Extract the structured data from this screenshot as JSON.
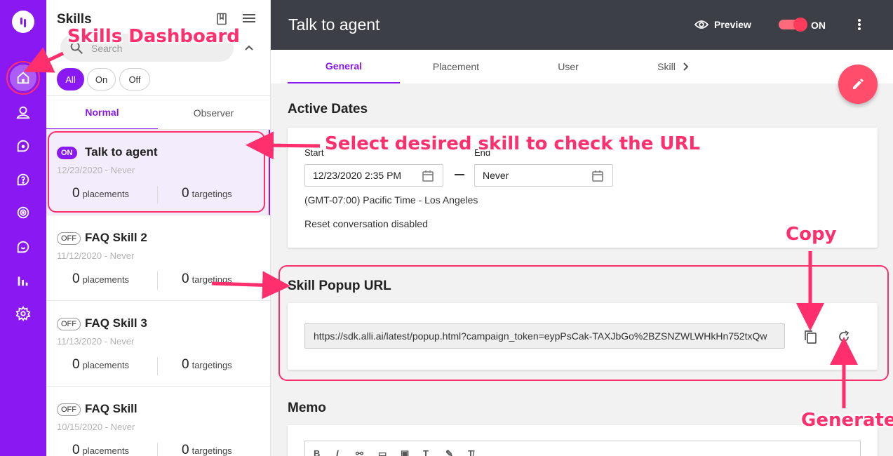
{
  "sidebar": {
    "items": [
      {
        "icon": "logo-icon"
      },
      {
        "icon": "home-icon"
      },
      {
        "icon": "user-icon"
      },
      {
        "icon": "chat-icon"
      },
      {
        "icon": "help-icon"
      },
      {
        "icon": "target-icon"
      },
      {
        "icon": "message-icon"
      },
      {
        "icon": "bar-chart-icon"
      },
      {
        "icon": "gear-icon"
      }
    ]
  },
  "skills_panel": {
    "title": "Skills",
    "search_placeholder": "Search",
    "filters": [
      "All",
      "On",
      "Off"
    ],
    "active_filter": "All",
    "tabs": [
      "Normal",
      "Observer"
    ],
    "active_tab": "Normal",
    "skills": [
      {
        "status": "ON",
        "name": "Talk to agent",
        "dates": "12/23/2020 - Never",
        "placements": "0",
        "placements_label": "placements",
        "targetings": "0",
        "targetings_label": "targetings",
        "selected": true
      },
      {
        "status": "OFF",
        "name": "FAQ Skill 2",
        "dates": "11/12/2020 - Never",
        "placements": "0",
        "placements_label": "placements",
        "targetings": "0",
        "targetings_label": "targetings",
        "selected": false
      },
      {
        "status": "OFF",
        "name": "FAQ Skill 3",
        "dates": "11/13/2020 - Never",
        "placements": "0",
        "placements_label": "placements",
        "targetings": "0",
        "targetings_label": "targetings",
        "selected": false
      },
      {
        "status": "OFF",
        "name": "FAQ Skill",
        "dates": "10/15/2020 - Never",
        "placements": "0",
        "placements_label": "placements",
        "targetings": "0",
        "targetings_label": "targetings",
        "selected": false
      }
    ]
  },
  "header": {
    "title": "Talk to agent",
    "preview_label": "Preview",
    "toggle_label": "ON"
  },
  "main_tabs": [
    "General",
    "Placement",
    "User",
    "Skill"
  ],
  "active_main_tab": "General",
  "active_dates": {
    "section_title": "Active Dates",
    "start_label": "Start",
    "end_label": "End",
    "start_value": "12/23/2020 2:35 PM",
    "end_value": "Never",
    "timezone": "(GMT-07:00) Pacific Time - Los Angeles",
    "reset_text": "Reset conversation disabled"
  },
  "popup_url": {
    "section_title": "Skill Popup URL",
    "url": "https://sdk.alli.ai/latest/popup.html?campaign_token=eypPsCak-TAXJbGo%2BZSNZWLWHkHn752txQw"
  },
  "memo": {
    "section_title": "Memo",
    "toolbar": [
      "B",
      "I",
      "link-icon",
      "image-icon",
      "video-icon",
      "text-size-icon",
      "pen-icon",
      "clear-format-icon"
    ]
  },
  "annotations": {
    "dashboard": "Skills Dashboard",
    "select": "Select desired skill to check the URL",
    "copy": "Copy",
    "generate": "Generate",
    "color": "#ff2f6d"
  },
  "colors": {
    "brand": "#8a18f2",
    "topbar": "#3c4046",
    "fab": "#ff4d6b"
  }
}
